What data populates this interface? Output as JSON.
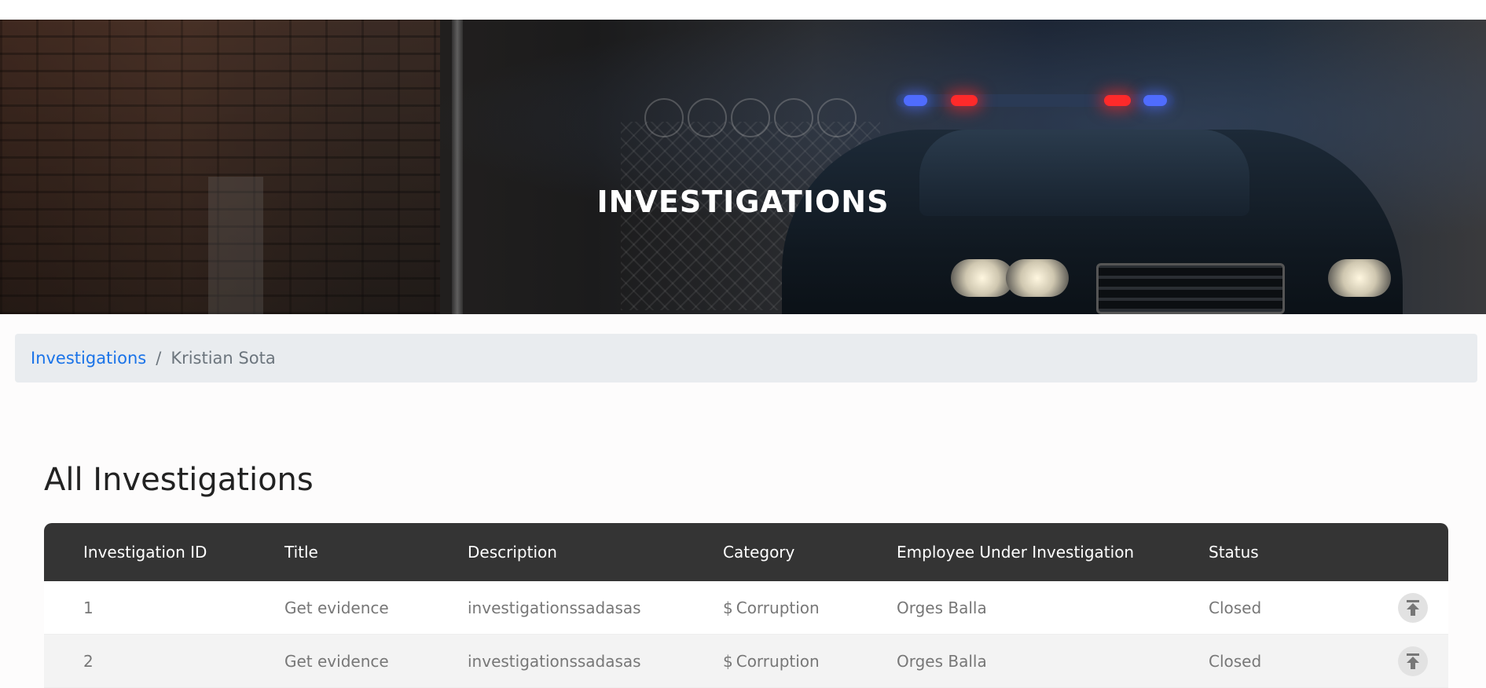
{
  "hero": {
    "title": "INVESTIGATIONS"
  },
  "breadcrumb": {
    "items": [
      {
        "label": "Investigations",
        "link": true
      },
      {
        "label": "Kristian Sota",
        "link": false
      }
    ],
    "separator": "/"
  },
  "main": {
    "section_title": "All Investigations",
    "table": {
      "columns": [
        "Investigation ID",
        "Title",
        "Description",
        "Category",
        "Employee Under Investigation",
        "Status"
      ],
      "rows": [
        {
          "id": "1",
          "title": "Get evidence",
          "description": "investigationssadasas",
          "category_icon": "$",
          "category": "Corruption",
          "employee": "Orges Balla",
          "status": "Closed",
          "action_icon": "arrow-to-top-icon"
        },
        {
          "id": "2",
          "title": "Get evidence",
          "description": "investigationssadasas",
          "category_icon": "$",
          "category": "Corruption",
          "employee": "Orges Balla",
          "status": "Closed",
          "action_icon": "arrow-to-top-icon"
        }
      ]
    }
  },
  "colors": {
    "link": "#1a73e8",
    "table_header_bg": "#343434",
    "breadcrumb_bg": "#e9ecef"
  }
}
